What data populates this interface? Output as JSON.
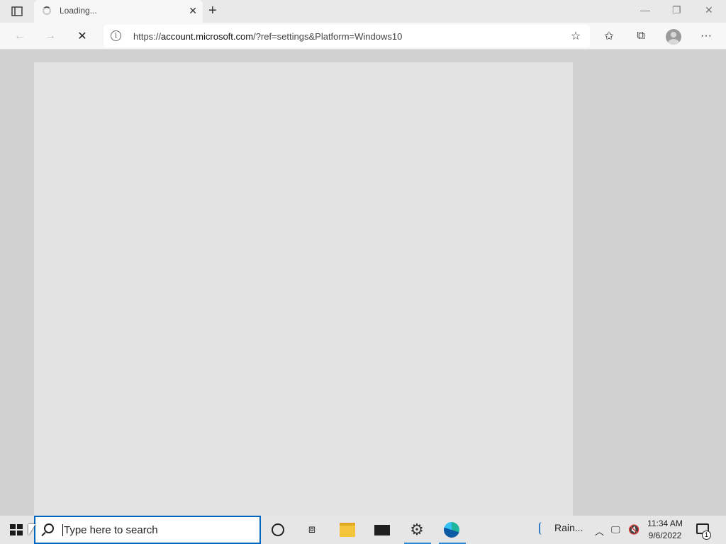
{
  "browser": {
    "tab": {
      "title": "Loading..."
    },
    "address": {
      "url_prefix": "https://",
      "url_host": "account.microsoft.com",
      "url_rest": "/?ref=settings&Platform=Windows10"
    }
  },
  "taskbar": {
    "search_placeholder": "Type here to search",
    "weather_label": "Rain...",
    "time": "11:34 AM",
    "date": "9/6/2022",
    "notification_count": "1"
  },
  "icons": {
    "tab_actions": "tab-actions-icon",
    "back": "arrow-left-icon",
    "forward": "arrow-right-icon",
    "stop": "stop-loading-icon",
    "favorite_add": "star-plus-icon",
    "favorites": "favorites-icon",
    "collections": "collections-icon",
    "menu": "more-icon"
  },
  "colors": {
    "accent": "#0067c0",
    "page_background": "#d1d1d1",
    "content_panel": "#e3e3e3"
  }
}
